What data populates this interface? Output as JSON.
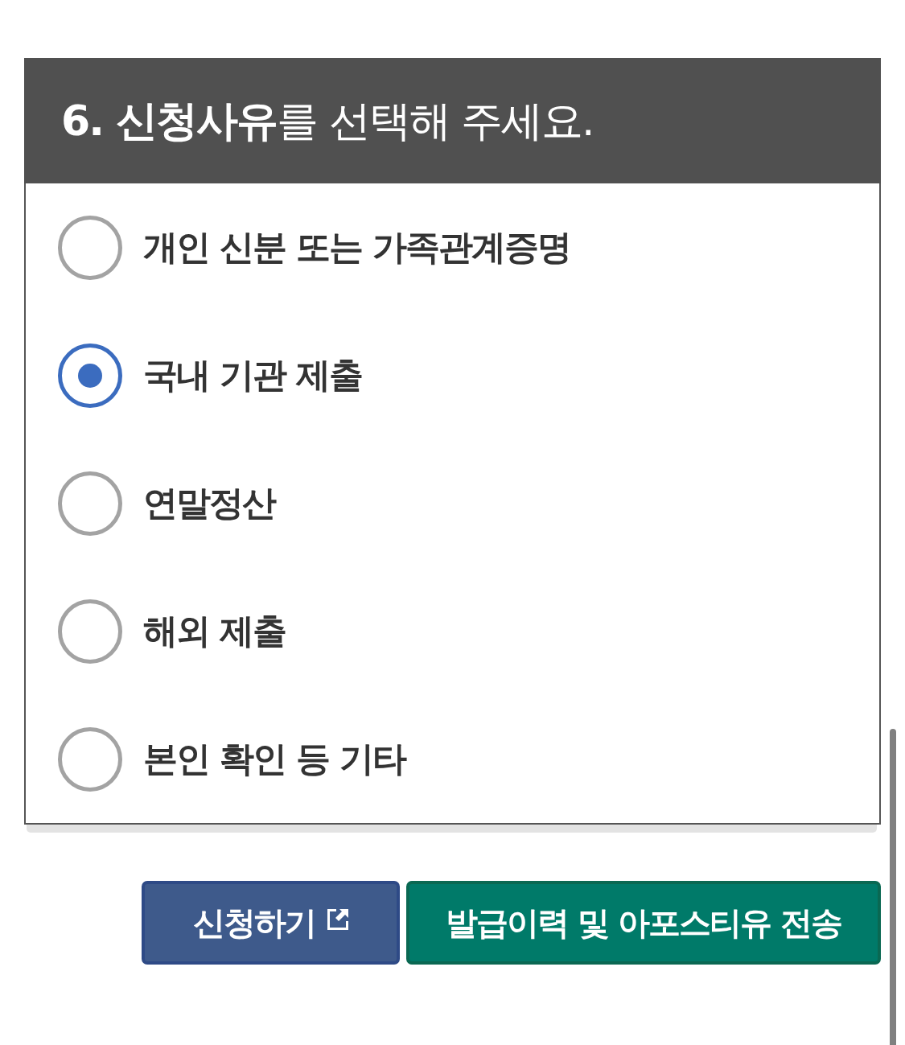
{
  "section": {
    "title": "**6. 신청사유**를 선택해 주세요."
  },
  "options": [
    {
      "label": "개인 신분 또는 가족관계증명",
      "selected": false
    },
    {
      "label": "국내 기관 제출",
      "selected": true
    },
    {
      "label": "연말정산",
      "selected": false
    },
    {
      "label": "해외 제출",
      "selected": false
    },
    {
      "label": "본인 확인 등 기타",
      "selected": false
    }
  ],
  "buttons": [
    {
      "label": "신청하기",
      "kind": "external"
    },
    {
      "label": "발급이력 및 아포스티유 전송",
      "kind": "send"
    }
  ]
}
